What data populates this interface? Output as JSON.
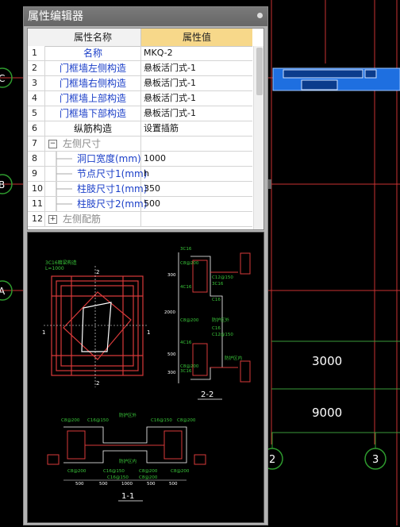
{
  "panel": {
    "title": "属性编辑器",
    "columns": {
      "name": "属性名称",
      "value": "属性值"
    },
    "rows": [
      {
        "num": "1",
        "name": "名称",
        "value": "MKQ-2",
        "style": "blue"
      },
      {
        "num": "2",
        "name": "门框墙左侧构造",
        "value": "悬板活门式-1",
        "style": "blue"
      },
      {
        "num": "3",
        "name": "门框墙右侧构造",
        "value": "悬板活门式-1",
        "style": "blue"
      },
      {
        "num": "4",
        "name": "门框墙上部构造",
        "value": "悬板活门式-1",
        "style": "blue"
      },
      {
        "num": "5",
        "name": "门框墙下部构造",
        "value": "悬板活门式-1",
        "style": "blue"
      },
      {
        "num": "6",
        "name": "纵筋构造",
        "value": "设置插筋",
        "style": "black"
      },
      {
        "num": "7",
        "name": "左侧尺寸",
        "value": "",
        "style": "group",
        "toggle": "−"
      },
      {
        "num": "8",
        "name": "洞口宽度(mm)",
        "value": "1000",
        "style": "sub"
      },
      {
        "num": "9",
        "name": "节点尺寸1(mm)",
        "value": "h",
        "style": "sub"
      },
      {
        "num": "10",
        "name": "柱肢尺寸1(mm)",
        "value": "350",
        "style": "sub"
      },
      {
        "num": "11",
        "name": "柱肢尺寸2(mm)",
        "value": "500",
        "style": "sub"
      },
      {
        "num": "12",
        "name": "左侧配筋",
        "value": "",
        "style": "group",
        "toggle": "+"
      }
    ]
  },
  "cad": {
    "axis_labels": [
      "C",
      "B",
      "A",
      "2",
      "3"
    ],
    "dimensions": [
      "3000",
      "9000"
    ]
  },
  "preview": {
    "section_labels": [
      "2-2",
      "1-1"
    ],
    "marks": [
      "1",
      "1",
      "2",
      "2"
    ],
    "rebar_labels": [
      "3C16",
      "C8@200",
      "4C16",
      "C12@150",
      "3C16",
      "C16",
      "C8@200",
      "C12@150",
      "C16",
      "防护区外",
      "4C16",
      "C8@200",
      "3C16",
      "防护区内",
      "C16@150",
      "C8@200",
      "C16@150",
      "C8@200",
      "防护区外",
      "防护区内",
      "C8@200",
      "C16@150",
      "C8@200",
      "C8@200",
      "C16@150",
      "C8@200",
      "3C16暗梁构造",
      "L=1000"
    ],
    "dims": [
      "300",
      "2000",
      "500",
      "300",
      "500",
      "500",
      "1000",
      "500",
      "500"
    ]
  },
  "colors": {
    "cad_bg": "#000000",
    "grid_line": "#d83a3a",
    "axis_circle": "#2e9a2e",
    "selected": "#1e6fe0",
    "header_value_bg": "#f7d88a",
    "prop_blue": "#1a3ec8"
  }
}
